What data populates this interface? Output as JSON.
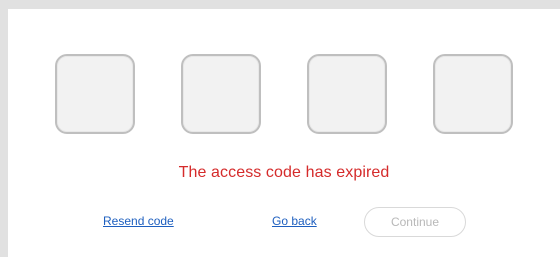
{
  "code_inputs": [
    {
      "value": ""
    },
    {
      "value": ""
    },
    {
      "value": ""
    },
    {
      "value": ""
    }
  ],
  "status": {
    "error_message": "The access code has expired"
  },
  "actions": {
    "resend_label": "Resend code",
    "go_back_label": "Go back",
    "continue_label": "Continue"
  },
  "colors": {
    "error": "#d52b2b",
    "link": "#1e5fbf",
    "disabled_text": "#b8b8b8"
  }
}
